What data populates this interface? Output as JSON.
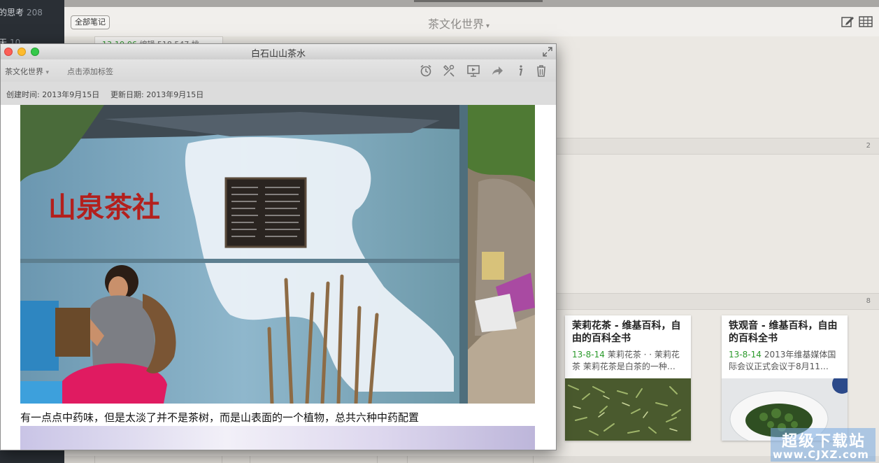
{
  "sidebar": {
    "items": [
      {
        "label": "的思考",
        "count": "208"
      },
      {
        "label": "天",
        "count": "10"
      }
    ]
  },
  "header": {
    "all_notes_button": "全部笔记",
    "notebook_title": "茶文化世界",
    "icons": [
      "new-note-icon",
      "grid-view-icon"
    ]
  },
  "background": {
    "note_meta": {
      "date": "13-10-06",
      "text": "编辑 518,547 桃"
    },
    "section_counts": [
      "2",
      "8"
    ]
  },
  "cards": [
    {
      "title": "茉莉花茶 - 维基百科，自由的百科全书",
      "date": "13-8-14",
      "snippet": "茉莉花茶 · · 茉莉花茶 茉莉花茶是白茶的一种…"
    },
    {
      "title": "铁观音 - 维基百科，自由的百科全书",
      "date": "13-8-14",
      "snippet": "2013年维基媒体国际会议正式会议于8月11…"
    }
  ],
  "note_window": {
    "title": "白石山山茶水",
    "notebook": "茶文化世界",
    "add_tag": "点击添加标签",
    "created_label": "创建时间: 2013年9月15日",
    "updated_label": "更新日期: 2013年9月15日",
    "toolbar_icons": [
      "reminder-icon",
      "share-tools-icon",
      "presentation-icon",
      "forward-icon",
      "info-icon",
      "trash-icon"
    ],
    "photo_sign": "山泉茶社",
    "body_text": "有一点点中药味，但是太淡了并不是茶树，而是山表面的一个植物，总共六种中药配置"
  },
  "watermark": {
    "line1": "超级下载站",
    "line2": "www.CJXZ.com"
  },
  "colors": {
    "date_green": "#2b9a2b",
    "sidebar_bg": "#2a2f35",
    "paper_bg": "#ebe8e3"
  }
}
